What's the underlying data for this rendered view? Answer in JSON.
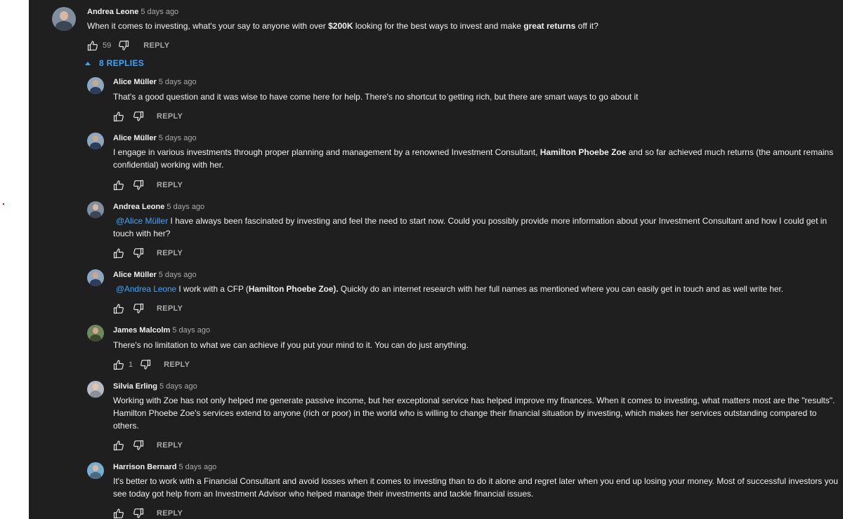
{
  "top_comment": {
    "author": "Andrea Leone",
    "time": "5 days ago",
    "text_parts": {
      "a": "When it comes to investing, what's your say to anyone with over ",
      "b": "$200K",
      "c": " looking for the best ways to invest and make ",
      "d": "great returns",
      "e": " off it?"
    },
    "likes": "59",
    "reply_label": "REPLY"
  },
  "replies_toggle": "8 REPLIES",
  "replies": [
    {
      "author": "Alice Müller",
      "time": "5 days ago",
      "text": "That's a good question and it was wise to have come here for help.  There's no shortcut to getting rich, but there are smart ways to go about it",
      "reply_label": "REPLY"
    },
    {
      "author": "Alice Müller",
      "time": "5 days ago",
      "text_parts": {
        "a": "I engage in various investments through proper planning and management by a renowned Investment Consultant, ",
        "b": "Hamilton Phoebe Zoe",
        "c": " and so far achieved much returns (the amount remains confidential) working with her."
      },
      "reply_label": "REPLY"
    },
    {
      "author": "Andrea Leone",
      "time": "5 days ago",
      "mention": "@Alice Müller",
      "text": "  I have always been fascinated by investing and feel the need to start now.  Could you possibly provide more information about your  Investment Consultant and how I could get in touch with her?",
      "reply_label": "REPLY"
    },
    {
      "author": "Alice Müller",
      "time": "5 days ago",
      "mention": "@Andrea Leone",
      "text_parts": {
        "a": "  I work  with a CFP (",
        "b": "Hamilton Phoebe Zoe).",
        "c": " Quickly do an internet research with her full names as  mentioned where you can easily get in touch and as well write her."
      },
      "reply_label": "REPLY"
    },
    {
      "author": "James Malcolm",
      "time": "5 days ago",
      "text": "There's no limitation to what we can achieve if you put your mind to it.  You can do just anything.",
      "likes": "1",
      "reply_label": "REPLY"
    },
    {
      "author": "Silvia Erling",
      "time": "5 days ago",
      "text": "Working with Zoe has not only helped me generate passive income, but her exceptional service has helped improve my finances.  When it comes to investing, what matters most are the \"results\".  Hamilton Phoebe Zoe's services extend to anyone (rich or poor) in the world who is willing to change their financial situation by investing, which makes her services outstanding compared to others.",
      "reply_label": "REPLY"
    },
    {
      "author": "Harrison Bernard",
      "time": "5 days ago",
      "text": "It's better to work with a Financial Consultant and avoid losses when it comes to investing than to do it alone and regret later when you end up losing your money.  Most of successful investors you see today got help from an  Investment Advisor who helped manage their investments and tackle financial issues.",
      "reply_label": "REPLY"
    }
  ],
  "icons": {
    "like": "thumbs-up-icon",
    "dislike": "thumbs-down-icon",
    "toggle": "caret-up-icon"
  },
  "colors": {
    "background": "#1f1f1f",
    "text": "#f1f1f1",
    "secondary": "#aaaaaa",
    "link": "#3ea6ff"
  }
}
